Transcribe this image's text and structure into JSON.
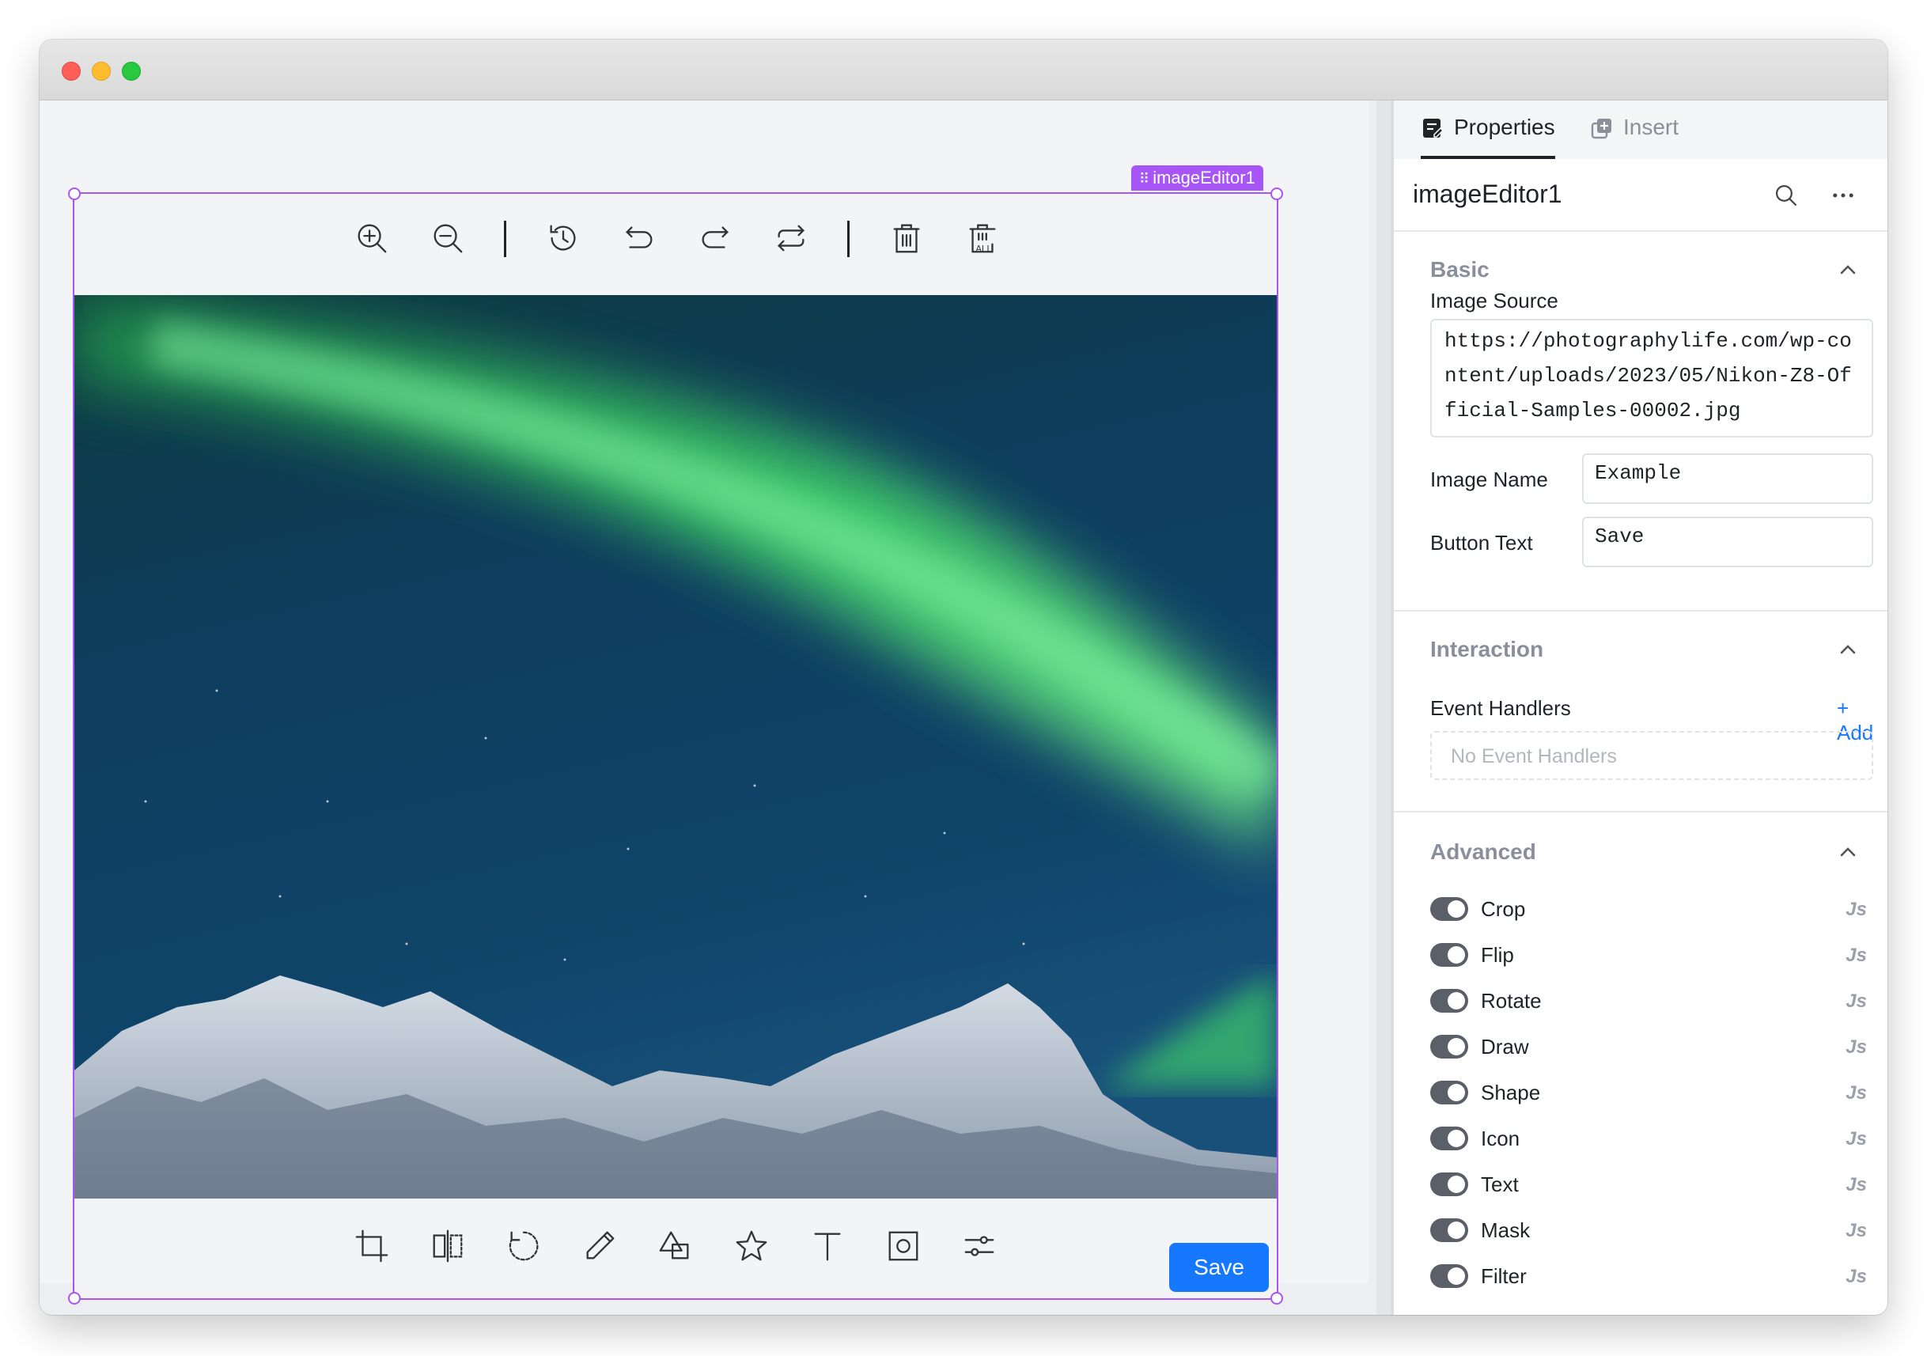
{
  "editor": {
    "component_name": "imageEditor1",
    "save_label": "Save",
    "top_tools": [
      "zoom-in-icon",
      "zoom-out-icon",
      "history-icon",
      "undo-icon",
      "redo-icon",
      "reset-icon",
      "delete-icon",
      "delete-all-icon"
    ],
    "bottom_tools": [
      "crop-icon",
      "flip-icon",
      "rotate-icon",
      "draw-icon",
      "shape-icon",
      "icon-star-icon",
      "text-icon",
      "mask-icon",
      "filter-icon"
    ],
    "delete_all_badge": "ALL"
  },
  "panel": {
    "tabs": [
      {
        "label": "Properties",
        "active": true
      },
      {
        "label": "Insert",
        "active": false
      }
    ],
    "component_name": "imageEditor1",
    "basic": {
      "title": "Basic",
      "image_source_label": "Image Source",
      "image_source_value": "https://photographylife.com/wp-content/uploads/2023/05/Nikon-Z8-Official-Samples-00002.jpg",
      "image_name_label": "Image Name",
      "image_name_value": "Example",
      "button_text_label": "Button Text",
      "button_text_value": "Save"
    },
    "interaction": {
      "title": "Interaction",
      "event_handlers_label": "Event Handlers",
      "add_label": "+ Add",
      "empty_text": "No Event Handlers"
    },
    "advanced": {
      "title": "Advanced",
      "toggles": [
        {
          "label": "Crop",
          "on": true
        },
        {
          "label": "Flip",
          "on": true
        },
        {
          "label": "Rotate",
          "on": true
        },
        {
          "label": "Draw",
          "on": true
        },
        {
          "label": "Shape",
          "on": true
        },
        {
          "label": "Icon",
          "on": true
        },
        {
          "label": "Text",
          "on": true
        },
        {
          "label": "Mask",
          "on": true
        },
        {
          "label": "Filter",
          "on": true
        }
      ],
      "js_label": "Js"
    }
  },
  "colors": {
    "selection": "#a855f7",
    "primary": "#1677ff",
    "toggle": "#5a5f68"
  }
}
